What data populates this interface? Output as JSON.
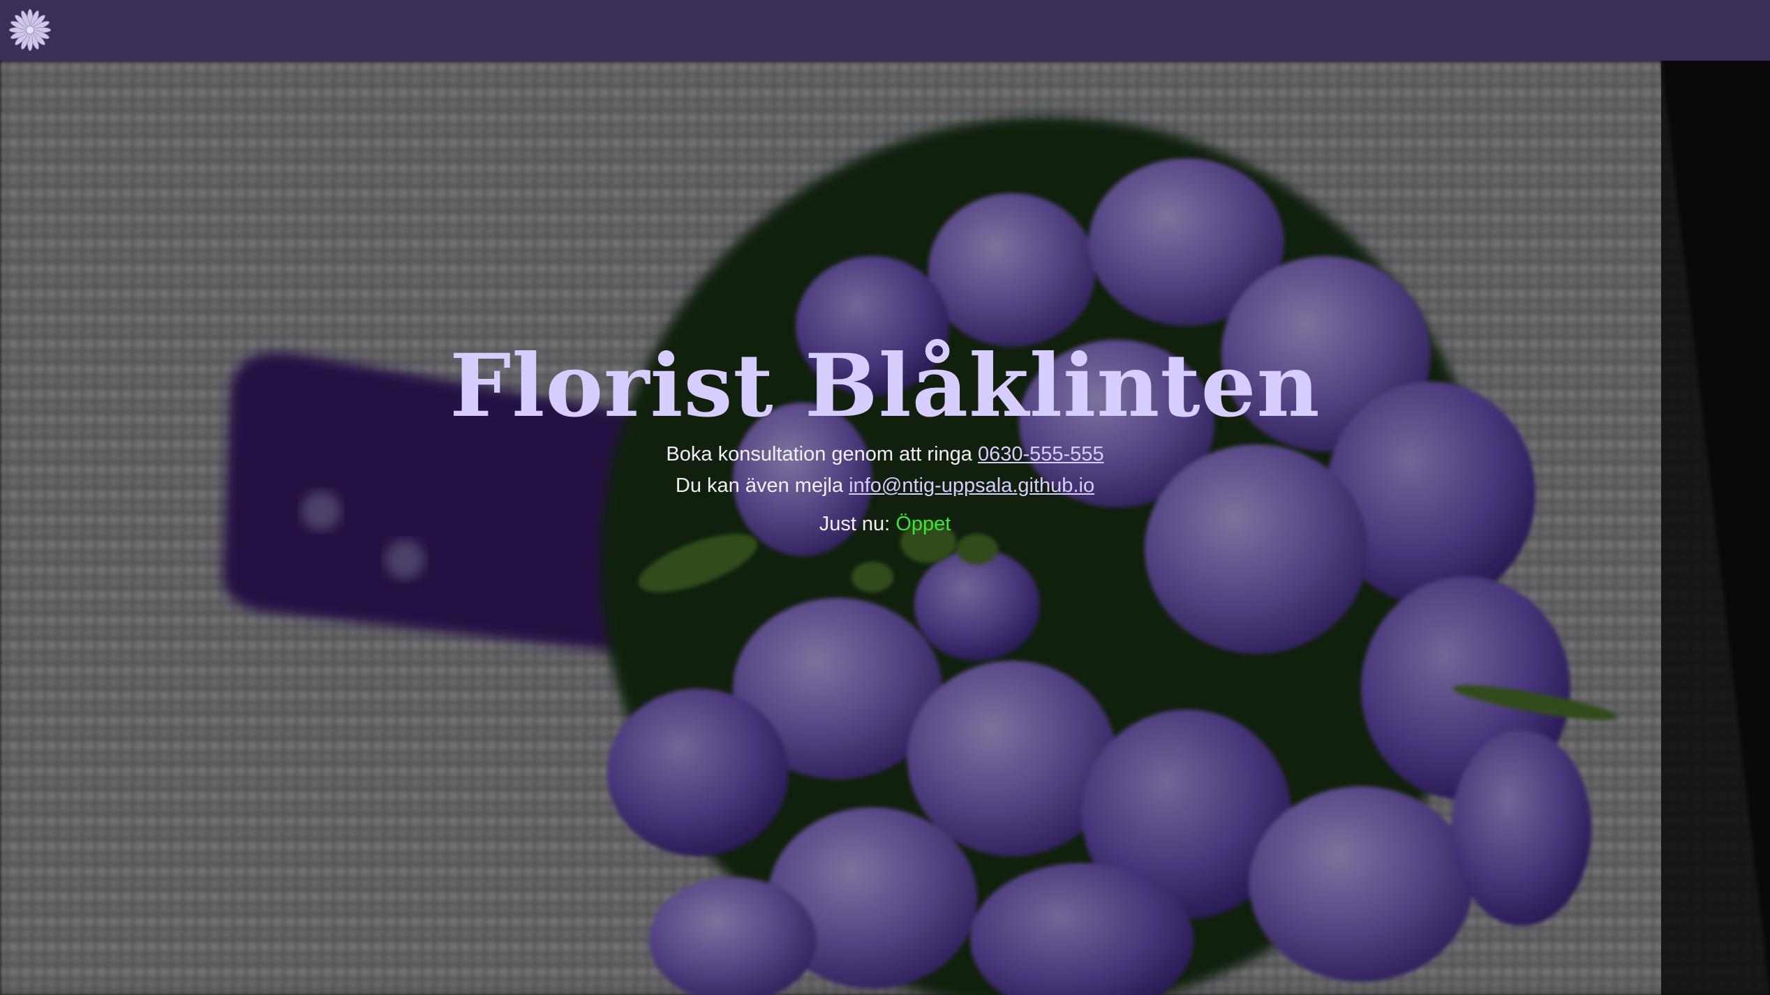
{
  "header": {
    "logo_icon": "flower-icon",
    "background_color": "#3b2f56"
  },
  "hero": {
    "background_image": "purple-flower-bouquet-photo",
    "title": "Florist Blåklinten",
    "phone_text": "Boka konsultation genom att ringa",
    "phone_number": "0630-555-555",
    "email_text": "Du kan även mejla",
    "email": "info@ntig-uppsala.github.io",
    "status_label": "Just nu:",
    "status_value": "Öppet"
  },
  "colors": {
    "title": "#d7ceff",
    "link": "#d7ceff",
    "status_open": "#39e639"
  }
}
